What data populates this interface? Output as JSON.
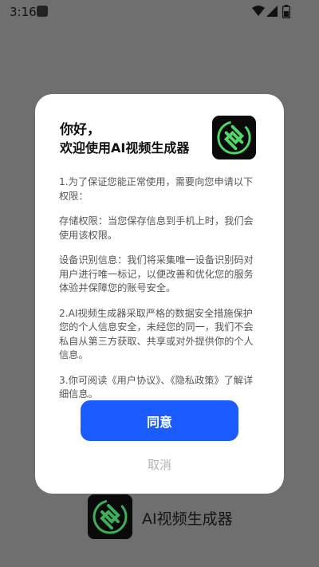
{
  "status_bar": {
    "time": "3:16",
    "icons": [
      "notification-icon",
      "wifi-icon",
      "signal-icon",
      "battery-icon"
    ]
  },
  "background_app": {
    "name": "AI视频生成器",
    "logo_icon": "ai-video-logo-icon"
  },
  "dialog": {
    "title_line1": "你好，",
    "title_line2": "欢迎使用AI视频生成器",
    "logo_icon": "ai-video-logo-icon",
    "paragraphs": [
      "1.为了保证您能正常使用，需要向您申请以下权限：",
      "存储权限：当您保存信息到手机上时，我们会使用该权限。",
      "设备识别信息：我们将采集唯一设备识别码对用户进行唯一标记，以便改善和优化您的服务体验并保障您的账号安全。",
      "2.AI视频生成器采取严格的数据安全措施保护您的个人信息安全，未经您的同一，我们不会私自从第三方获取、共享或对外提供你的个人信息。",
      "3.你可阅读《用户协议》、《隐私政策》了解详细信息。"
    ],
    "agree_label": "同意",
    "cancel_label": "取消"
  },
  "colors": {
    "accent": "#1a5cff",
    "logo_green": "#4cd964",
    "overlay": "#6f6f6f"
  }
}
